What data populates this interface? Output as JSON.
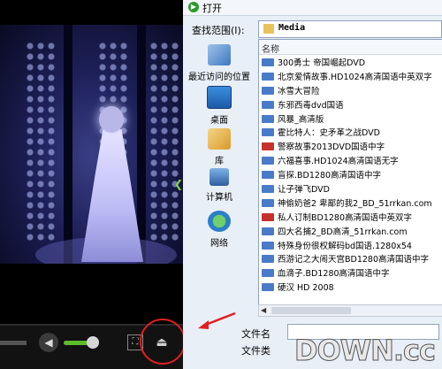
{
  "dialog": {
    "title": "打开",
    "look_in_label": "查找范围(I):",
    "look_in_value": "Media",
    "column_name": "名称",
    "file_name_label": "文件名",
    "file_type_label": "文件类"
  },
  "places": [
    {
      "label": "最近访问的位置",
      "icon": "recent-places-icon"
    },
    {
      "label": "桌面",
      "icon": "desktop-icon"
    },
    {
      "label": "库",
      "icon": "libraries-icon"
    },
    {
      "label": "计算机",
      "icon": "computer-icon"
    },
    {
      "label": "网络",
      "icon": "network-icon"
    }
  ],
  "files": [
    {
      "name": "300勇士 帝国崛起DVD",
      "icon": "video-file-icon",
      "color": "#4a7bc8"
    },
    {
      "name": "北京爱情故事.HD1024高清国语中英双字",
      "icon": "video-file-icon",
      "color": "#4a7bc8"
    },
    {
      "name": "冰雪大冒险",
      "icon": "video-file-icon",
      "color": "#4a7bc8"
    },
    {
      "name": "东邪西毒dvd国语",
      "icon": "video-file-icon",
      "color": "#4a7bc8"
    },
    {
      "name": "风暴_高清版",
      "icon": "video-file-icon",
      "color": "#4a7bc8"
    },
    {
      "name": "霍比特人：史矛革之战DVD",
      "icon": "video-file-icon",
      "color": "#4a7bc8"
    },
    {
      "name": "警察故事2013DVD国语中字",
      "icon": "rmvb-file-icon",
      "color": "#c8302b"
    },
    {
      "name": "六福喜事.HD1024高清国语无字",
      "icon": "video-file-icon",
      "color": "#4a7bc8"
    },
    {
      "name": "盲探.BD1280高清国语中字",
      "icon": "video-file-icon",
      "color": "#4a7bc8"
    },
    {
      "name": "让子弹飞DVD",
      "icon": "video-file-icon",
      "color": "#4a7bc8"
    },
    {
      "name": "神偷奶爸2 卑鄙的我2_BD_51rrkan.com",
      "icon": "video-file-icon",
      "color": "#4a7bc8"
    },
    {
      "name": "私人订制BD1280高清国语中英双字",
      "icon": "rmvb-file-icon",
      "color": "#c8302b"
    },
    {
      "name": "四大名捕2_BD高清_51rrkan.com",
      "icon": "video-file-icon",
      "color": "#4a7bc8"
    },
    {
      "name": "特殊身份很权解码bd国语.1280x54",
      "icon": "video-file-icon",
      "color": "#4a7bc8"
    },
    {
      "name": "西游记之大闹天宫BD1280高清国语中字",
      "icon": "video-file-icon",
      "color": "#4a7bc8"
    },
    {
      "name": "血滴子.BD1280高清国语中字",
      "icon": "video-file-icon",
      "color": "#4a7bc8"
    },
    {
      "name": "硬汉 HD 2008",
      "icon": "video-file-icon",
      "color": "#4a7bc8"
    }
  ],
  "player": {
    "volume_level": 0.75,
    "controls": [
      "volume-icon",
      "fullscreen-icon",
      "eject-icon"
    ]
  },
  "watermark": "DOWN.cc",
  "colors": {
    "accent_red": "#e02020",
    "dialog_bg": "#e9eff7",
    "volume_green": "#5dbb2a"
  }
}
